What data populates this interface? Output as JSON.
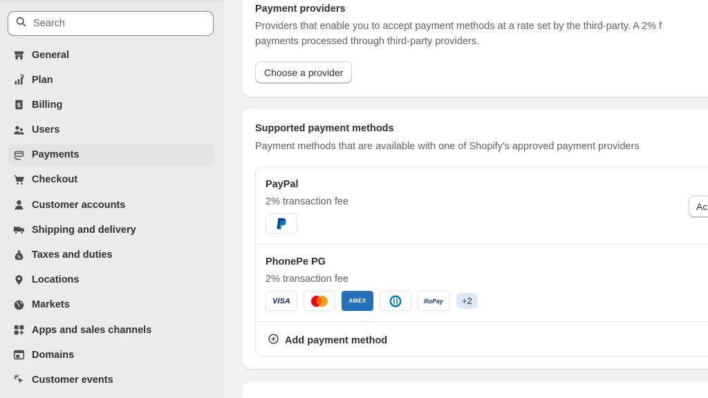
{
  "search": {
    "placeholder": "Search"
  },
  "sidebar": {
    "items": [
      {
        "label": "General",
        "icon": "store-icon"
      },
      {
        "label": "Plan",
        "icon": "plan-icon"
      },
      {
        "label": "Billing",
        "icon": "billing-icon"
      },
      {
        "label": "Users",
        "icon": "users-icon"
      },
      {
        "label": "Payments",
        "icon": "payments-icon",
        "active": true
      },
      {
        "label": "Checkout",
        "icon": "cart-icon"
      },
      {
        "label": "Customer accounts",
        "icon": "person-icon"
      },
      {
        "label": "Shipping and delivery",
        "icon": "truck-icon"
      },
      {
        "label": "Taxes and duties",
        "icon": "tax-icon"
      },
      {
        "label": "Locations",
        "icon": "location-pin-icon"
      },
      {
        "label": "Markets",
        "icon": "globe-icon"
      },
      {
        "label": "Apps and sales channels",
        "icon": "apps-icon"
      },
      {
        "label": "Domains",
        "icon": "domain-icon"
      },
      {
        "label": "Customer events",
        "icon": "cursor-click-icon"
      }
    ]
  },
  "providers_card": {
    "title": "Payment providers",
    "desc_line1": "Providers that enable you to accept payment methods at a rate set by the third-party. A 2% f",
    "desc_line2": "payments processed through third-party providers.",
    "button": "Choose a provider"
  },
  "supported_card": {
    "title": "Supported payment methods",
    "desc": "Payment methods that are available with one of Shopify's approved payment providers",
    "methods": [
      {
        "name": "PayPal",
        "fee": "2% transaction fee",
        "action_label": "Ac"
      },
      {
        "name": "PhonePe PG",
        "fee": "2% transaction fee",
        "more_count": "+2"
      }
    ],
    "add_method": "Add payment method"
  },
  "logo_text": {
    "visa": "VISA",
    "amex": "AMEX",
    "rupay": "RuPay"
  },
  "colors": {
    "sidebar_bg": "#ebebeb",
    "page_bg": "#f1f1f1",
    "accent_badge": "#dbe9f9",
    "paypal_blue": "#003087",
    "amex_blue": "#2671b9"
  }
}
